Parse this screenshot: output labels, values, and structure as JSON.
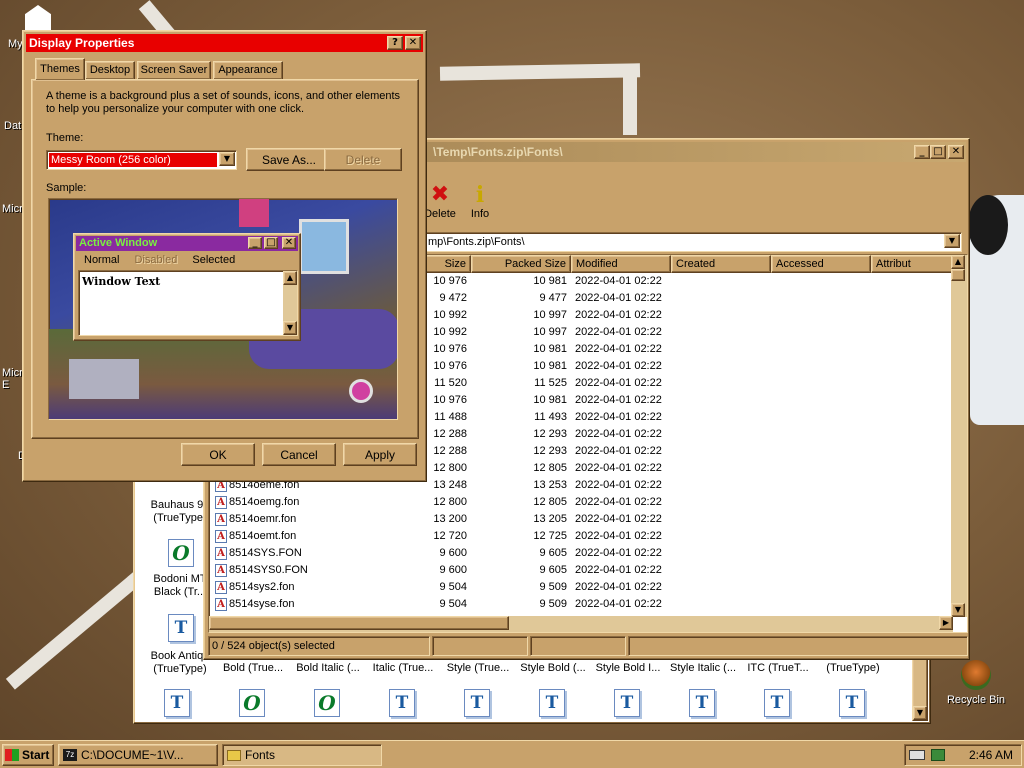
{
  "desktop": {
    "icons": [
      "My",
      "Dat",
      "Micr",
      "Micr\nE",
      "D"
    ],
    "recycle_bin": "Recycle Bin"
  },
  "display_dialog": {
    "title": "Display Properties",
    "help_btn": "?",
    "close_btn": "✕",
    "tabs": [
      "Themes",
      "Desktop",
      "Screen Saver",
      "Appearance"
    ],
    "description": "A theme is a background plus a set of sounds, icons, and other elements to help you personalize your computer with one click.",
    "theme_label": "Theme:",
    "theme_value": "Messy Room (256 color)",
    "save_as": "Save As...",
    "delete": "Delete",
    "sample_label": "Sample:",
    "preview": {
      "active_window": "Active Window",
      "menu": [
        "Normal",
        "Disabled",
        "Selected"
      ],
      "window_text": "Window Text"
    },
    "ok": "OK",
    "cancel": "Cancel",
    "apply": "Apply"
  },
  "zip_window": {
    "title": "\\Temp\\Fonts.zip\\Fonts\\",
    "toolbar": [
      {
        "label": "Delete",
        "icon": "delete-icon"
      },
      {
        "label": "Info",
        "icon": "info-icon"
      }
    ],
    "address": "mp\\Fonts.zip\\Fonts\\",
    "columns": [
      "Size",
      "Packed Size",
      "Modified",
      "Created",
      "Accessed",
      "Attribut"
    ],
    "rows": [
      {
        "name": "",
        "size": "10 976",
        "packed": "10 981",
        "modified": "2022-04-01 02:22"
      },
      {
        "name": "",
        "size": "9 472",
        "packed": "9 477",
        "modified": "2022-04-01 02:22"
      },
      {
        "name": "",
        "size": "10 992",
        "packed": "10 997",
        "modified": "2022-04-01 02:22"
      },
      {
        "name": "",
        "size": "10 992",
        "packed": "10 997",
        "modified": "2022-04-01 02:22"
      },
      {
        "name": "",
        "size": "10 976",
        "packed": "10 981",
        "modified": "2022-04-01 02:22"
      },
      {
        "name": "",
        "size": "10 976",
        "packed": "10 981",
        "modified": "2022-04-01 02:22"
      },
      {
        "name": "",
        "size": "11 520",
        "packed": "11 525",
        "modified": "2022-04-01 02:22"
      },
      {
        "name": "",
        "size": "10 976",
        "packed": "10 981",
        "modified": "2022-04-01 02:22"
      },
      {
        "name": "",
        "size": "11 488",
        "packed": "11 493",
        "modified": "2022-04-01 02:22"
      },
      {
        "name": "",
        "size": "12 288",
        "packed": "12 293",
        "modified": "2022-04-01 02:22"
      },
      {
        "name": "",
        "size": "12 288",
        "packed": "12 293",
        "modified": "2022-04-01 02:22"
      },
      {
        "name": "",
        "size": "12 800",
        "packed": "12 805",
        "modified": "2022-04-01 02:22"
      },
      {
        "name": "8514oeme.fon",
        "size": "13 248",
        "packed": "13 253",
        "modified": "2022-04-01 02:22"
      },
      {
        "name": "8514oemg.fon",
        "size": "12 800",
        "packed": "12 805",
        "modified": "2022-04-01 02:22"
      },
      {
        "name": "8514oemr.fon",
        "size": "13 200",
        "packed": "13 205",
        "modified": "2022-04-01 02:22"
      },
      {
        "name": "8514oemt.fon",
        "size": "12 720",
        "packed": "12 725",
        "modified": "2022-04-01 02:22"
      },
      {
        "name": "8514SYS.FON",
        "size": "9 600",
        "packed": "9 605",
        "modified": "2022-04-01 02:22"
      },
      {
        "name": "8514SYS0.FON",
        "size": "9 600",
        "packed": "9 605",
        "modified": "2022-04-01 02:22"
      },
      {
        "name": "8514sys2.fon",
        "size": "9 504",
        "packed": "9 509",
        "modified": "2022-04-01 02:22"
      },
      {
        "name": "8514syse.fon",
        "size": "9 504",
        "packed": "9 509",
        "modified": "2022-04-01 02:22"
      }
    ],
    "status": "0 / 524 object(s) selected"
  },
  "fonts_window": {
    "side_items": [
      {
        "label": "Bauhaus 93\n(TrueType)",
        "icon": "truetype-icon"
      },
      {
        "label": "Bodoni MT\nBlack (Tr...",
        "icon": "opentype-icon"
      },
      {
        "label": "Book Antiqu\n(TrueType)",
        "icon": "truetype-icon"
      }
    ],
    "row_labels": [
      "Bold (True...",
      "Bold Italic (...",
      "Italic (True...",
      "Style (True...",
      "Style Bold (...",
      "Style Bold I...",
      "Style Italic (...",
      "ITC (TrueT...",
      "(TrueType)"
    ],
    "bottom_icons": [
      "truetype-icon",
      "opentype-icon",
      "opentype-icon",
      "truetype-icon",
      "truetype-icon",
      "truetype-icon",
      "truetype-icon",
      "truetype-icon",
      "truetype-icon",
      "truetype-icon"
    ]
  },
  "taskbar": {
    "start": "Start",
    "tasks": [
      {
        "label": "C:\\DOCUME~1\\V...",
        "icon": "7zip-icon"
      },
      {
        "label": "Fonts",
        "icon": "folder-icon"
      }
    ],
    "clock": "2:46 AM"
  }
}
